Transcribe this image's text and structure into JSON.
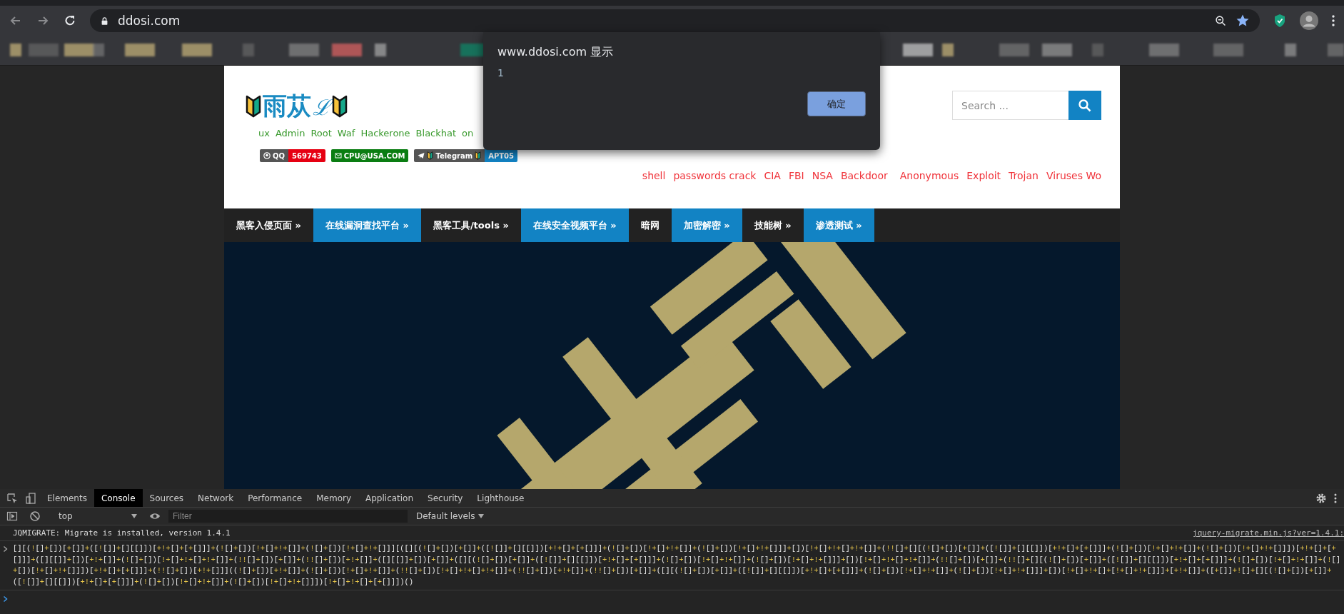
{
  "browser": {
    "url": "ddosi.com"
  },
  "site": {
    "logo": {
      "text": "雨苁",
      "script": "ℒ"
    },
    "green_tags": [
      "ux",
      "Admin",
      "Root",
      "Waf",
      "Hackerone",
      "Blackhat",
      "on"
    ],
    "badges": [
      {
        "kind": "qq",
        "label": "QQ",
        "value": "569743",
        "color": "#e60012"
      },
      {
        "kind": "mail",
        "label": "CPU@USA.COM",
        "color": "#0a7d12"
      },
      {
        "kind": "telegram",
        "label": "Telegram",
        "value": "APT05",
        "color": "#1283c4"
      }
    ],
    "red_tags": [
      "shell",
      "passwords crack",
      "CIA",
      "FBI",
      "NSA",
      "Backdoor",
      "Anonymous",
      "Exploit",
      "Trojan",
      "Viruses Wo"
    ],
    "search": {
      "placeholder": "Search ..."
    },
    "nav": [
      {
        "label": "黑客入侵页面 »",
        "kind": "dark"
      },
      {
        "label": "在线漏洞查找平台 »",
        "kind": "blue"
      },
      {
        "label": "黑客工具/tools »",
        "kind": "dark"
      },
      {
        "label": "在线安全视频平台 »",
        "kind": "blue"
      },
      {
        "label": "暗网",
        "kind": "dark"
      },
      {
        "label": "加密解密 »",
        "kind": "blue"
      },
      {
        "label": "技能树 »",
        "kind": "dark"
      },
      {
        "label": "渗透测试 »",
        "kind": "blue"
      }
    ]
  },
  "dialog": {
    "title": "www.ddosi.com 显示",
    "message": "1",
    "button": "确定"
  },
  "devtools": {
    "tabs": [
      {
        "label": "Elements",
        "selected": false
      },
      {
        "label": "Console",
        "selected": true
      },
      {
        "label": "Sources",
        "selected": false
      },
      {
        "label": "Network",
        "selected": false
      },
      {
        "label": "Performance",
        "selected": false
      },
      {
        "label": "Memory",
        "selected": false
      },
      {
        "label": "Application",
        "selected": false
      },
      {
        "label": "Security",
        "selected": false
      },
      {
        "label": "Lighthouse",
        "selected": false
      }
    ],
    "context": "top",
    "filter": {
      "placeholder": "Filter"
    },
    "levels": "Default levels",
    "messages": [
      {
        "kind": "log",
        "text": "JQMIGRATE: Migrate is installed, version 1.4.1",
        "source": "jquery-migrate.min.js?ver=1.4.1:"
      },
      {
        "kind": "input",
        "text": "[][(![]+[])[+[]]+([![]]+[][[]])[+!+[]+[+[]]]+(![]+[])[!+[]+!+[]]+(![]+[])[!+[]+!+[]]][([][(![]+[])[+[]]+([![]]+[][[]])[+!+[]+[+[]]]+(![]+[])[!+[]+!+[]]+(![]+[])[!+[]+!+[]]]+[])[!+[]+!+[]+!+[]]+(!![]+[][(![]+[])[+[]]+([![]]+[][[]])[+!+[]+[+[]]]+(![]+[])[!+[]+!+[]]+(![]+[])[!+[]+!+[]]])[+!+[]+[+[]]]+([][[]]+[])[+!+[]]+(![]+[])[!+[]+!+[]+!+[]]+(!![]+[])[+[]]+(!![]+[])[+!+[]]+([][[]]+[])[+[]]+([][(![]+[])[+[]]+([![]]+[][[]])[+!+[]+[+[]]]+(![]+[])[!+[]+!+[]]+(![]+[])[!+[]+!+[]]]+[])[!+[]+!+[]+!+[]]+(!![]+[])[+[]]+(!![]+[][(![]+[])[+[]]+([![]]+[][[]])[+!+[]+[+[]]]+(![]+[])[!+[]+!+[]]+(![]+[])[!+[]+!+[]]])[+!+[]+[+[]]]+(!![]+[])[+!+[]]]((![]+[])[+!+[]]+(![]+[])[!+[]+!+[]]+(!![]+[])[!+[]+!+[]+!+[]]+(!![]+[])[+!+[]]+(!![]+[])[+[]]+([][(![]+[])[+[]]+([![]]+[][[]])[+!+[]+[+[]]]+(![]+[])[!+[]+!+[]]+(![]+[])[!+[]+!+[]]]+[])[!+[]+!+[]+[!+[]+!+[]]]+[+!+[]]+([+[]]+![]+[][(![]+[])[+[]]+([![]]+[][[]])[+!+[]+[+[]]]+(![]+[])[!+[]+!+[]]+(![]+[])[!+[]+!+[]]])[!+[]+!+[]+[+[]]])()"
      },
      {
        "kind": "prompt"
      }
    ]
  }
}
